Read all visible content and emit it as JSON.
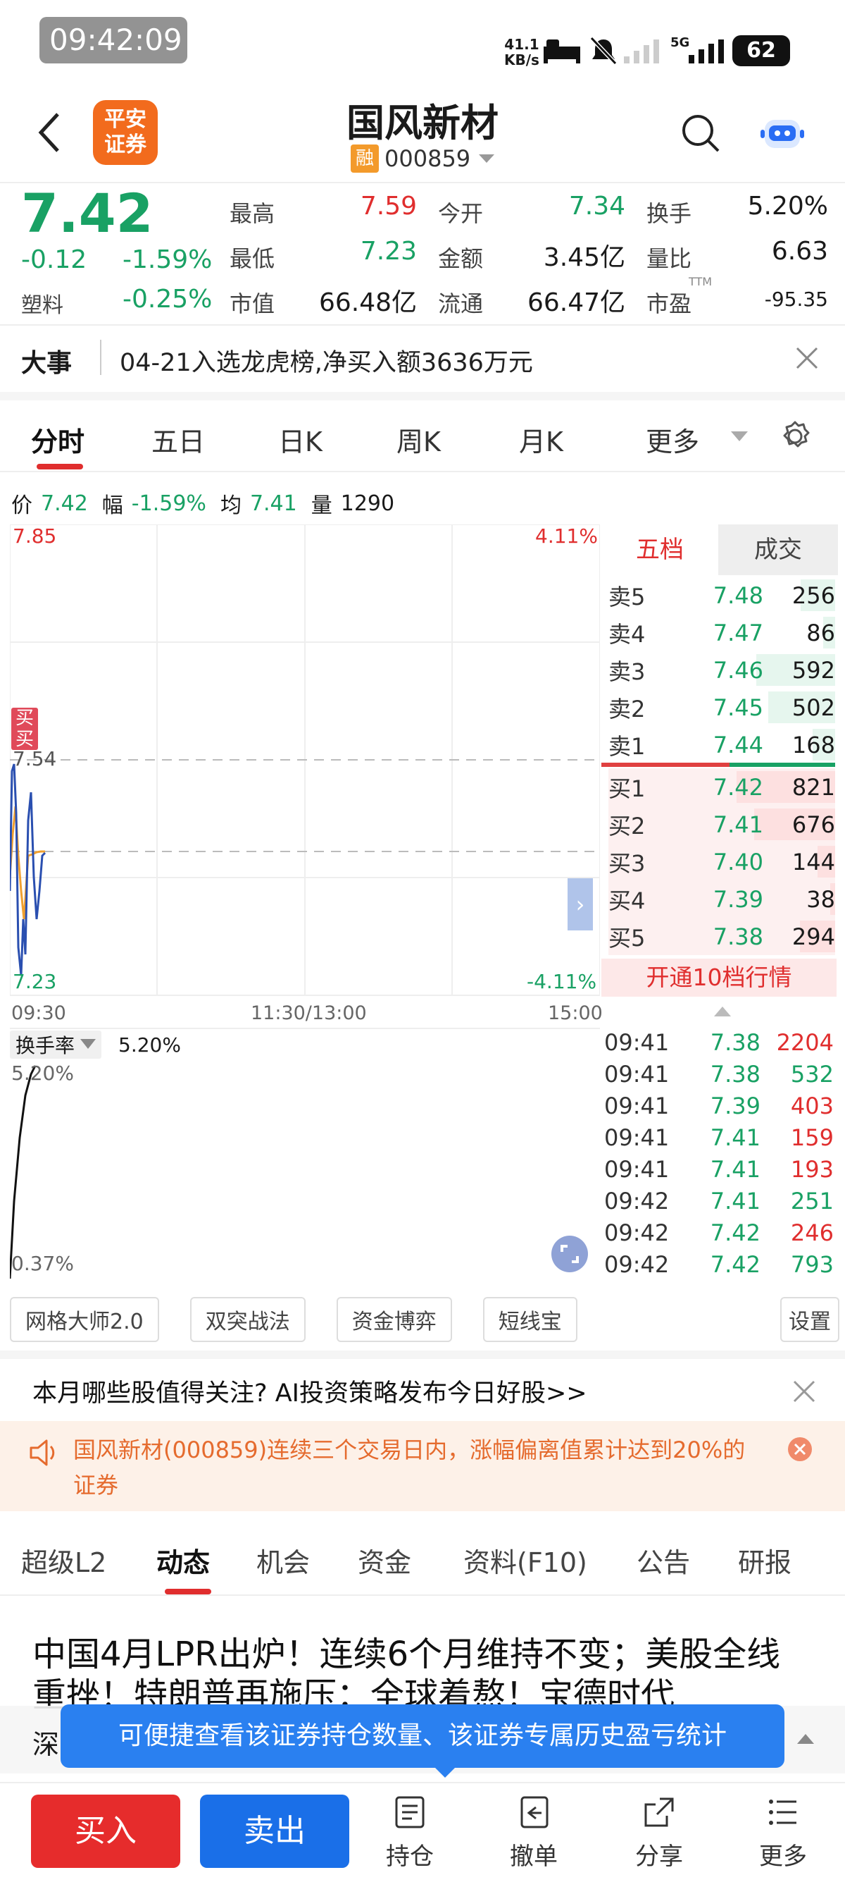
{
  "status": {
    "time": "09:42:09",
    "net_speed_top": "41.1",
    "net_speed_unit": "KB/s",
    "network": "5G",
    "battery": "62"
  },
  "header": {
    "broker_logo_text_1": "平安",
    "broker_logo_text_2": "证券",
    "title": "国风新材",
    "margin_badge": "融",
    "code": "000859"
  },
  "quote": {
    "price": "7.42",
    "change": "-0.12",
    "change_pct": "-1.59%",
    "sector": "塑料",
    "sector_pct": "-0.25%",
    "rows": [
      [
        {
          "label": "最高",
          "value": "7.59",
          "color": "red"
        },
        {
          "label": "今开",
          "value": "7.34",
          "color": "green"
        },
        {
          "label": "换手",
          "value": "5.20%",
          "color": "black"
        }
      ],
      [
        {
          "label": "最低",
          "value": "7.23",
          "color": "green"
        },
        {
          "label": "金额",
          "value": "3.45亿",
          "color": "black"
        },
        {
          "label": "量比",
          "value": "6.63",
          "color": "black"
        }
      ],
      [
        {
          "label": "市值",
          "value": "66.48亿",
          "color": "black"
        },
        {
          "label": "流通",
          "value": "66.47亿",
          "color": "black"
        },
        {
          "label": "市盈",
          "value": "-95.35",
          "color": "black",
          "sup": "TTM"
        }
      ]
    ]
  },
  "news_banner": {
    "tag": "大事",
    "text": "04-21入选龙虎榜,净买入额3636万元"
  },
  "chart_tabs": [
    "分时",
    "五日",
    "日K",
    "周K",
    "月K",
    "更多"
  ],
  "chart_info": {
    "price_label": "价",
    "price": "7.42",
    "range_label": "幅",
    "range": "-1.59%",
    "avg_label": "均",
    "avg": "7.41",
    "vol_label": "量",
    "vol": "1290"
  },
  "chart": {
    "top_price": "7.85",
    "top_pct": "4.11%",
    "mid_price": "7.54",
    "bottom_price": "7.23",
    "bottom_pct": "-4.11%",
    "time_start": "09:30",
    "time_mid": "11:30/13:00",
    "time_end": "15:00",
    "buy_mark": "买",
    "sell_mark": "买"
  },
  "indicator": {
    "name": "换手率",
    "value": "5.20%",
    "top": "5.20%",
    "bottom": "0.37%"
  },
  "order_book": {
    "tab_five": "五档",
    "tab_trades": "成交",
    "asks": [
      {
        "label": "卖5",
        "price": "7.48",
        "vol": "256",
        "fill": 0.35
      },
      {
        "label": "卖4",
        "price": "7.47",
        "vol": "86",
        "fill": 0.12
      },
      {
        "label": "卖3",
        "price": "7.46",
        "vol": "592",
        "fill": 0.8
      },
      {
        "label": "卖2",
        "price": "7.45",
        "vol": "502",
        "fill": 0.68
      },
      {
        "label": "卖1",
        "price": "7.44",
        "vol": "168",
        "fill": 0.23
      }
    ],
    "bids": [
      {
        "label": "买1",
        "price": "7.42",
        "vol": "821",
        "fill": 1.0
      },
      {
        "label": "买2",
        "price": "7.41",
        "vol": "676",
        "fill": 0.82
      },
      {
        "label": "买3",
        "price": "7.40",
        "vol": "144",
        "fill": 0.18
      },
      {
        "label": "买4",
        "price": "7.39",
        "vol": "38",
        "fill": 0.05
      },
      {
        "label": "买5",
        "price": "7.38",
        "vol": "294",
        "fill": 0.36
      }
    ],
    "open_level10": "开通10档行情"
  },
  "trades": [
    {
      "time": "09:41",
      "price": "7.38",
      "vol": "2204",
      "pc": "green",
      "vc": "red"
    },
    {
      "time": "09:41",
      "price": "7.38",
      "vol": "532",
      "pc": "green",
      "vc": "green"
    },
    {
      "time": "09:41",
      "price": "7.39",
      "vol": "403",
      "pc": "green",
      "vc": "red"
    },
    {
      "time": "09:41",
      "price": "7.41",
      "vol": "159",
      "pc": "green",
      "vc": "red"
    },
    {
      "time": "09:41",
      "price": "7.41",
      "vol": "193",
      "pc": "green",
      "vc": "red"
    },
    {
      "time": "09:42",
      "price": "7.41",
      "vol": "251",
      "pc": "green",
      "vc": "green"
    },
    {
      "time": "09:42",
      "price": "7.42",
      "vol": "246",
      "pc": "green",
      "vc": "red"
    },
    {
      "time": "09:42",
      "price": "7.42",
      "vol": "793",
      "pc": "green",
      "vc": "green"
    }
  ],
  "tool_chips": [
    "网格大师2.0",
    "双突战法",
    "资金博弈",
    "短线宝"
  ],
  "settings_label": "设置",
  "promo": "本月哪些股值得关注? AI投资策略发布今日好股>>",
  "warning": "国风新材(000859)连续三个交易日内，涨幅偏离值累计达到20%的证券",
  "content_tabs": [
    "超级L2",
    "动态",
    "机会",
    "资金",
    "资料(F10)",
    "公告",
    "研报"
  ],
  "article_title": "中国4月LPR出炉！连续6个月维持不变；美股全线重挫！特朗普再施压：全球着熬！宝德时代",
  "ticker_partial": "深",
  "tooltip": "可便捷查看该证券持仓数量、该证券专属历史盈亏统计",
  "bottom": {
    "buy": "买入",
    "sell": "卖出",
    "tools": [
      "持仓",
      "撤单",
      "分享",
      "更多"
    ]
  },
  "colors": {
    "red": "#e02e2e",
    "green": "#19a164",
    "blue": "#1a6fe8",
    "accent_orange": "#f39a2b"
  }
}
